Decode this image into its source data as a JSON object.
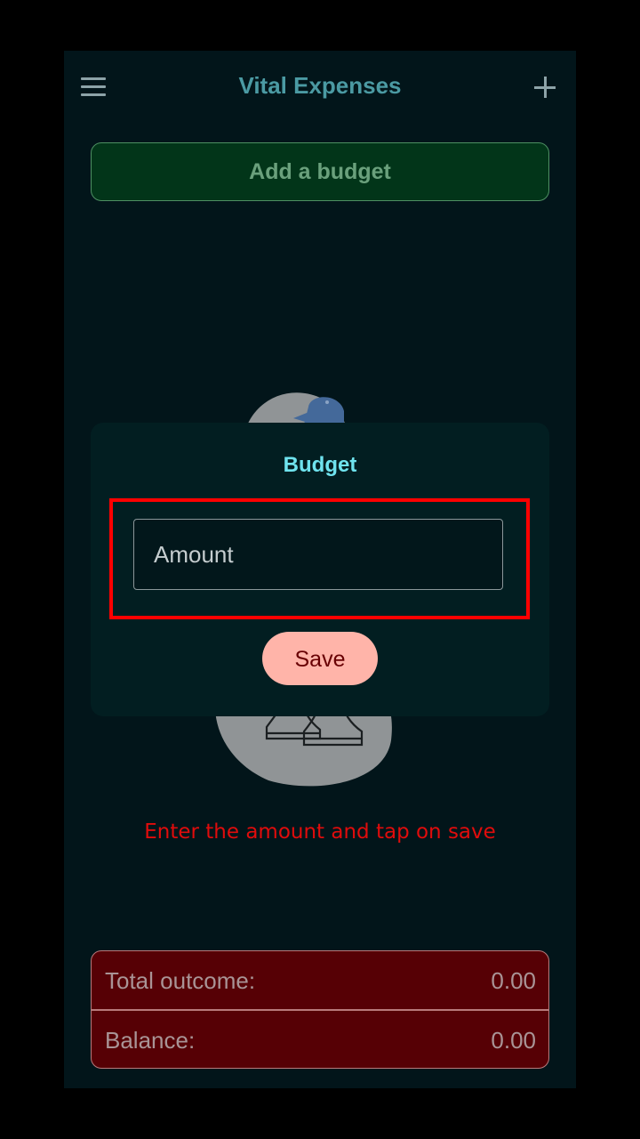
{
  "header": {
    "title": "Vital Expenses",
    "menu_icon": "hamburger-menu-icon",
    "add_icon": "plus-icon"
  },
  "add_budget": {
    "label": "Add a budget"
  },
  "hint": {
    "text": "Enter the amount and tap on save"
  },
  "summary": {
    "total_outcome_label": "Total outcome:",
    "total_outcome_value": "0.00",
    "balance_label": "Balance:",
    "balance_value": "0.00"
  },
  "dialog": {
    "title": "Budget",
    "amount_placeholder": "Amount",
    "amount_value": "",
    "save_label": "Save"
  },
  "colors": {
    "background": "#02151a",
    "accent_title": "#4b9aa3",
    "add_budget_bg": "#023519",
    "summary_bg": "#560005",
    "save_bg": "#ffb4a9",
    "hint": "#e00c0c",
    "highlight": "#ff0000"
  }
}
